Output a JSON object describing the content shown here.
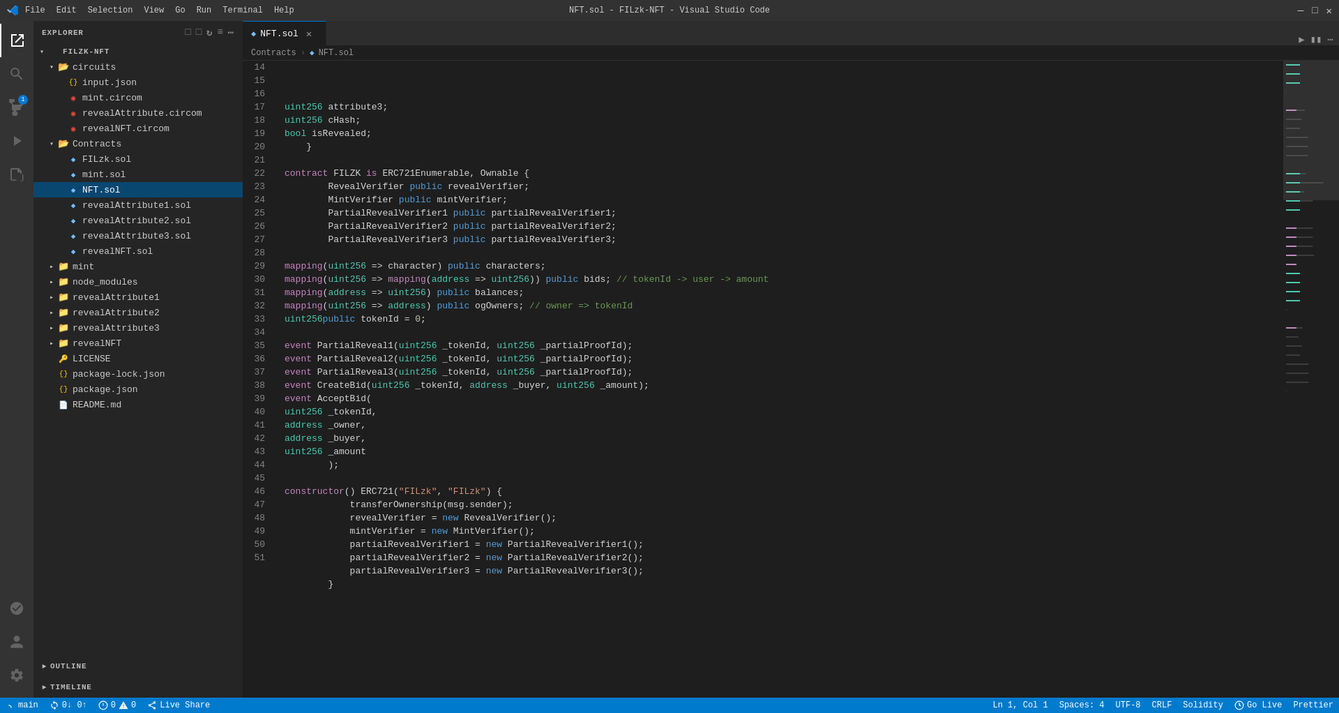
{
  "titleBar": {
    "title": "NFT.sol - FILzk-NFT - Visual Studio Code",
    "menu": [
      "File",
      "Edit",
      "Selection",
      "View",
      "Go",
      "Run",
      "Terminal",
      "Help"
    ],
    "logo": "◆"
  },
  "activityBar": {
    "icons": [
      {
        "name": "explorer-icon",
        "symbol": "⎘",
        "active": true
      },
      {
        "name": "search-icon",
        "symbol": "🔍",
        "active": false
      },
      {
        "name": "source-control-icon",
        "symbol": "⑂",
        "active": false,
        "badge": "1"
      },
      {
        "name": "run-debug-icon",
        "symbol": "▷",
        "active": false
      },
      {
        "name": "extensions-icon",
        "symbol": "⊞",
        "active": false
      },
      {
        "name": "remote-icon",
        "symbol": "⟨⟩",
        "active": false
      }
    ],
    "bottomIcons": [
      {
        "name": "account-icon",
        "symbol": "👤"
      },
      {
        "name": "settings-icon",
        "symbol": "⚙"
      }
    ]
  },
  "sidebar": {
    "title": "Explorer",
    "projectName": "FILZK-NFT",
    "tree": [
      {
        "id": "filzk-nft-root",
        "label": "FILZK-NFT",
        "type": "root",
        "indent": 0,
        "expanded": true,
        "arrow": "▾"
      },
      {
        "id": "circuits-folder",
        "label": "circuits",
        "type": "folder",
        "indent": 1,
        "expanded": true,
        "arrow": "▾"
      },
      {
        "id": "input-json",
        "label": "input.json",
        "type": "json",
        "indent": 2,
        "arrow": ""
      },
      {
        "id": "mint-circom",
        "label": "mint.circom",
        "type": "circom",
        "indent": 2,
        "arrow": ""
      },
      {
        "id": "revealAttribute-circom",
        "label": "revealAttribute.circom",
        "type": "circom",
        "indent": 2,
        "arrow": ""
      },
      {
        "id": "revealNFT-circom",
        "label": "revealNFT.circom",
        "type": "circom",
        "indent": 2,
        "arrow": ""
      },
      {
        "id": "contracts-folder",
        "label": "Contracts",
        "type": "folder",
        "indent": 1,
        "expanded": true,
        "arrow": "▾"
      },
      {
        "id": "FILzk-sol",
        "label": "FILzk.sol",
        "type": "sol",
        "indent": 2,
        "arrow": ""
      },
      {
        "id": "mint-sol",
        "label": "mint.sol",
        "type": "sol",
        "indent": 2,
        "arrow": ""
      },
      {
        "id": "NFT-sol",
        "label": "NFT.sol",
        "type": "sol",
        "indent": 2,
        "arrow": "",
        "active": true
      },
      {
        "id": "revealAttribute1-sol",
        "label": "revealAttribute1.sol",
        "type": "sol",
        "indent": 2,
        "arrow": ""
      },
      {
        "id": "revealAttribute2-sol",
        "label": "revealAttribute2.sol",
        "type": "sol",
        "indent": 2,
        "arrow": ""
      },
      {
        "id": "revealAttribute3-sol",
        "label": "revealAttribute3.sol",
        "type": "sol",
        "indent": 2,
        "arrow": ""
      },
      {
        "id": "revealNFT-sol",
        "label": "revealNFT.sol",
        "type": "sol",
        "indent": 2,
        "arrow": ""
      },
      {
        "id": "mint-folder",
        "label": "mint",
        "type": "folder",
        "indent": 1,
        "expanded": false,
        "arrow": "▸"
      },
      {
        "id": "node_modules-folder",
        "label": "node_modules",
        "type": "folder",
        "indent": 1,
        "expanded": false,
        "arrow": "▸"
      },
      {
        "id": "revealAttribute1-folder",
        "label": "revealAttribute1",
        "type": "folder",
        "indent": 1,
        "expanded": false,
        "arrow": "▸"
      },
      {
        "id": "revealAttribute2-folder",
        "label": "revealAttribute2",
        "type": "folder",
        "indent": 1,
        "expanded": false,
        "arrow": "▸"
      },
      {
        "id": "revealAttribute3-folder",
        "label": "revealAttribute3",
        "type": "folder",
        "indent": 1,
        "expanded": false,
        "arrow": "▸"
      },
      {
        "id": "revealNFT-folder",
        "label": "revealNFT",
        "type": "folder",
        "indent": 1,
        "expanded": false,
        "arrow": "▸"
      },
      {
        "id": "license-file",
        "label": "LICENSE",
        "type": "license",
        "indent": 1,
        "arrow": ""
      },
      {
        "id": "package-lock-json",
        "label": "package-lock.json",
        "type": "json",
        "indent": 1,
        "arrow": ""
      },
      {
        "id": "package-json",
        "label": "package.json",
        "type": "json",
        "indent": 1,
        "arrow": ""
      },
      {
        "id": "readme-md",
        "label": "README.md",
        "type": "md",
        "indent": 1,
        "arrow": ""
      }
    ]
  },
  "tabs": [
    {
      "id": "nft-sol-tab",
      "label": "NFT.sol",
      "active": true,
      "modified": false
    }
  ],
  "breadcrumb": {
    "items": [
      "Contracts",
      "NFT.sol"
    ]
  },
  "editor": {
    "startLine": 14,
    "lines": [
      {
        "num": 14,
        "tokens": [
          {
            "t": "        uint256 attribute3;",
            "c": ""
          }
        ]
      },
      {
        "num": 15,
        "tokens": [
          {
            "t": "        uint256 cHash;",
            "c": ""
          }
        ]
      },
      {
        "num": 16,
        "tokens": [
          {
            "t": "        bool isRevealed;",
            "c": ""
          }
        ]
      },
      {
        "num": 17,
        "tokens": [
          {
            "t": "    }",
            "c": ""
          }
        ]
      },
      {
        "num": 18,
        "tokens": [
          {
            "t": "",
            "c": ""
          }
        ]
      },
      {
        "num": 19,
        "tokens": [
          {
            "t": "    contract FILZK is ERC721Enumerable, Ownable {",
            "c": ""
          }
        ]
      },
      {
        "num": 20,
        "tokens": [
          {
            "t": "        RevealVerifier public revealVerifier;",
            "c": ""
          }
        ]
      },
      {
        "num": 21,
        "tokens": [
          {
            "t": "        MintVerifier public mintVerifier;",
            "c": ""
          }
        ]
      },
      {
        "num": 22,
        "tokens": [
          {
            "t": "        PartialRevealVerifier1 public partialRevealVerifier1;",
            "c": ""
          }
        ]
      },
      {
        "num": 23,
        "tokens": [
          {
            "t": "        PartialRevealVerifier2 public partialRevealVerifier2;",
            "c": ""
          }
        ]
      },
      {
        "num": 24,
        "tokens": [
          {
            "t": "        PartialRevealVerifier3 public partialRevealVerifier3;",
            "c": ""
          }
        ]
      },
      {
        "num": 25,
        "tokens": [
          {
            "t": "",
            "c": ""
          }
        ]
      },
      {
        "num": 26,
        "tokens": [
          {
            "t": "        mapping(uint256 => character) public characters;",
            "c": ""
          }
        ]
      },
      {
        "num": 27,
        "tokens": [
          {
            "t": "        mapping(uint256 => mapping(address => uint256)) public bids; // tokenId -> user -> amount",
            "c": ""
          }
        ]
      },
      {
        "num": 28,
        "tokens": [
          {
            "t": "        mapping(address => uint256) public balances;",
            "c": ""
          }
        ]
      },
      {
        "num": 29,
        "tokens": [
          {
            "t": "        mapping(uint256 => address) public ogOwners; // owner => tokenId",
            "c": ""
          }
        ]
      },
      {
        "num": 30,
        "tokens": [
          {
            "t": "        uint256 public tokenId = 0;",
            "c": ""
          }
        ]
      },
      {
        "num": 31,
        "tokens": [
          {
            "t": "",
            "c": ""
          }
        ]
      },
      {
        "num": 32,
        "tokens": [
          {
            "t": "        event PartialReveal1(uint256 _tokenId, uint256 _partialProofId);",
            "c": ""
          }
        ]
      },
      {
        "num": 33,
        "tokens": [
          {
            "t": "        event PartialReveal2(uint256 _tokenId, uint256 _partialProofId);",
            "c": ""
          }
        ]
      },
      {
        "num": 34,
        "tokens": [
          {
            "t": "        event PartialReveal3(uint256 _tokenId, uint256 _partialProofId);",
            "c": ""
          }
        ]
      },
      {
        "num": 35,
        "tokens": [
          {
            "t": "        event CreateBid(uint256 _tokenId, address _buyer, uint256 _amount);",
            "c": ""
          }
        ]
      },
      {
        "num": 36,
        "tokens": [
          {
            "t": "        event AcceptBid(",
            "c": ""
          }
        ]
      },
      {
        "num": 37,
        "tokens": [
          {
            "t": "            uint256 _tokenId,",
            "c": ""
          }
        ]
      },
      {
        "num": 38,
        "tokens": [
          {
            "t": "            address _owner,",
            "c": ""
          }
        ]
      },
      {
        "num": 39,
        "tokens": [
          {
            "t": "            address _buyer,",
            "c": ""
          }
        ]
      },
      {
        "num": 40,
        "tokens": [
          {
            "t": "            uint256 _amount",
            "c": ""
          }
        ]
      },
      {
        "num": 41,
        "tokens": [
          {
            "t": "        );",
            "c": ""
          }
        ]
      },
      {
        "num": 42,
        "tokens": [
          {
            "t": "",
            "c": ""
          }
        ]
      },
      {
        "num": 43,
        "tokens": [
          {
            "t": "        constructor() ERC721(\"FILzk\", \"FILzk\") {",
            "c": ""
          }
        ]
      },
      {
        "num": 44,
        "tokens": [
          {
            "t": "            transferOwnership(msg.sender);",
            "c": ""
          }
        ]
      },
      {
        "num": 45,
        "tokens": [
          {
            "t": "            revealVerifier = new RevealVerifier();",
            "c": ""
          }
        ]
      },
      {
        "num": 46,
        "tokens": [
          {
            "t": "            mintVerifier = new MintVerifier();",
            "c": ""
          }
        ]
      },
      {
        "num": 47,
        "tokens": [
          {
            "t": "            partialRevealVerifier1 = new PartialRevealVerifier1();",
            "c": ""
          }
        ]
      },
      {
        "num": 48,
        "tokens": [
          {
            "t": "            partialRevealVerifier2 = new PartialRevealVerifier2();",
            "c": ""
          }
        ]
      },
      {
        "num": 49,
        "tokens": [
          {
            "t": "            partialRevealVerifier3 = new PartialRevealVerifier3();",
            "c": ""
          }
        ]
      },
      {
        "num": 50,
        "tokens": [
          {
            "t": "        }",
            "c": ""
          }
        ]
      },
      {
        "num": 51,
        "tokens": [
          {
            "t": "",
            "c": ""
          }
        ]
      }
    ]
  },
  "outline": {
    "title": "Outline",
    "collapsed": true
  },
  "timeline": {
    "title": "Timeline",
    "collapsed": true
  },
  "statusBar": {
    "branch": "main",
    "sync": "0↓ 0↑",
    "errors": "0",
    "warnings": "0",
    "liveShare": "Live Share",
    "position": "Ln 1, Col 1",
    "spaces": "Spaces: 4",
    "encoding": "UTF-8",
    "lineEnding": "CRLF",
    "language": "Solidity",
    "goLive": "Go Live",
    "prettier": "Prettier"
  }
}
